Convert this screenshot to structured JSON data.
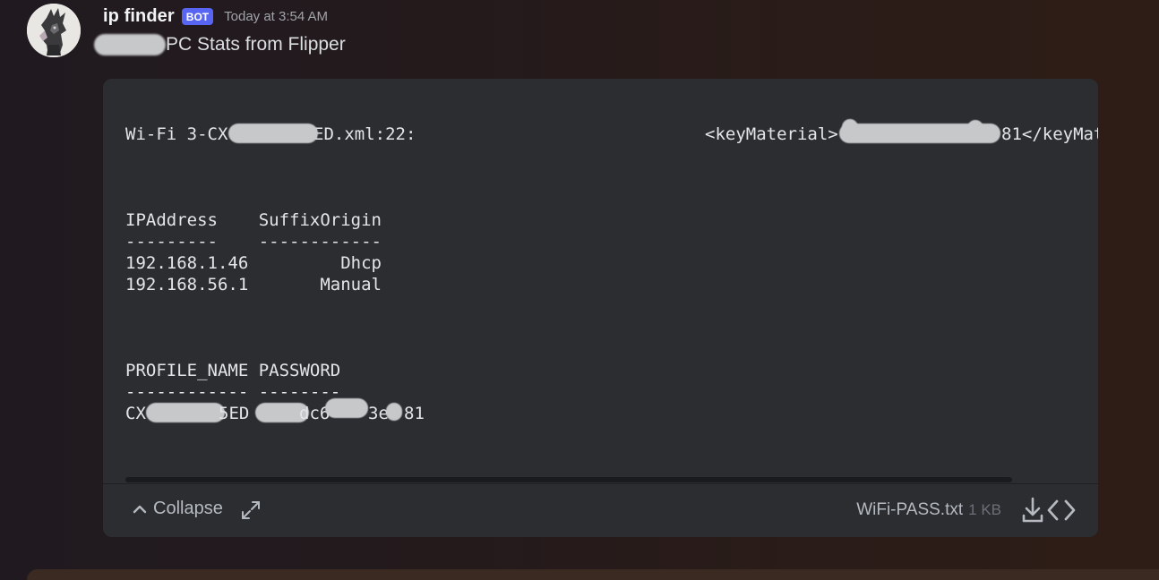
{
  "message": {
    "author": "ip finder",
    "bot_tag": "BOT",
    "timestamp": "Today at 3:54 AM",
    "content": "PC Stats from Flipper"
  },
  "attachment": {
    "code_lines": [
      "Wi-Fi 3-CX",
      "ED.xml:22:",
      "<keyMaterial>",
      "81</keyMat",
      "IPAddress    SuffixOrigin",
      "---------    ------------",
      "192.168.1.46         Dhcp",
      "192.168.56.1       Manual",
      "PROFILE_NAME PASSWORD",
      "------------ --------",
      "CX",
      "5ED",
      "dc6",
      "3e",
      "81"
    ],
    "collapse_label": "Collapse",
    "file_name": "WiFi-PASS.txt",
    "file_size": "1 KB"
  },
  "icons": {
    "avatar": "avatar-image",
    "collapse": "chevron-up-icon",
    "expand": "expand-arrows-icon",
    "download": "download-icon",
    "code": "code-brackets-icon"
  },
  "colors": {
    "bot_tag": "#5865f2",
    "embed_bg": "#2b2d31",
    "text": "#dbdee1",
    "muted": "#b5bac1"
  }
}
